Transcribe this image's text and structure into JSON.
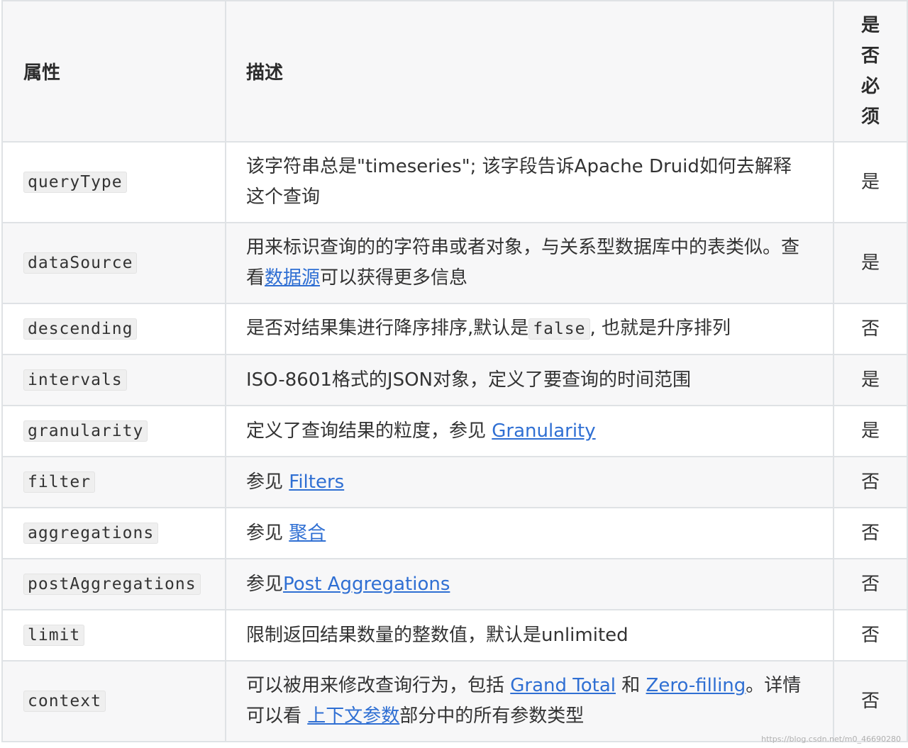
{
  "header": {
    "col_property": "属性",
    "col_description": "描述",
    "col_required": [
      "是",
      "否",
      "必",
      "须"
    ]
  },
  "rows": [
    {
      "property": "queryType",
      "desc": [
        {
          "text": "该字符串总是\"timeseries\"; 该字段告诉Apache Druid如何去解释这个查询"
        }
      ],
      "required": "是"
    },
    {
      "property": "dataSource",
      "desc": [
        {
          "text": "用来标识查询的的字符串或者对象，与关系型数据库中的表类似。查看"
        },
        {
          "link": "数据源"
        },
        {
          "text": "可以获得更多信息"
        }
      ],
      "required": "是"
    },
    {
      "property": "descending",
      "desc": [
        {
          "text": "是否对结果集进行降序排序,默认是"
        },
        {
          "code": "false"
        },
        {
          "text": ", 也就是升序排列"
        }
      ],
      "required": "否"
    },
    {
      "property": "intervals",
      "desc": [
        {
          "text": "ISO-8601格式的JSON对象，定义了要查询的时间范围"
        }
      ],
      "required": "是"
    },
    {
      "property": "granularity",
      "desc": [
        {
          "text": "定义了查询结果的粒度，参见 "
        },
        {
          "link": "Granularity"
        }
      ],
      "required": "是"
    },
    {
      "property": "filter",
      "desc": [
        {
          "text": "参见 "
        },
        {
          "link": "Filters"
        }
      ],
      "required": "否"
    },
    {
      "property": "aggregations",
      "desc": [
        {
          "text": "参见 "
        },
        {
          "link": "聚合"
        }
      ],
      "required": "否"
    },
    {
      "property": "postAggregations",
      "desc": [
        {
          "text": "参见"
        },
        {
          "link": "Post Aggregations"
        }
      ],
      "required": "否"
    },
    {
      "property": "limit",
      "desc": [
        {
          "text": "限制返回结果数量的整数值，默认是unlimited"
        }
      ],
      "required": "否"
    },
    {
      "property": "context",
      "desc": [
        {
          "text": "可以被用来修改查询行为，包括 "
        },
        {
          "link": "Grand Total"
        },
        {
          "text": " 和 "
        },
        {
          "link": "Zero-filling"
        },
        {
          "text": "。详情可以看 "
        },
        {
          "link": "上下文参数"
        },
        {
          "text": "部分中的所有参数类型"
        }
      ],
      "required": "否"
    }
  ],
  "watermark": "https://blog.csdn.net/m0_46690280",
  "colors": {
    "link": "#2f6fd3",
    "border": "#dfe2e5",
    "stripe": "#f7f7f8"
  }
}
